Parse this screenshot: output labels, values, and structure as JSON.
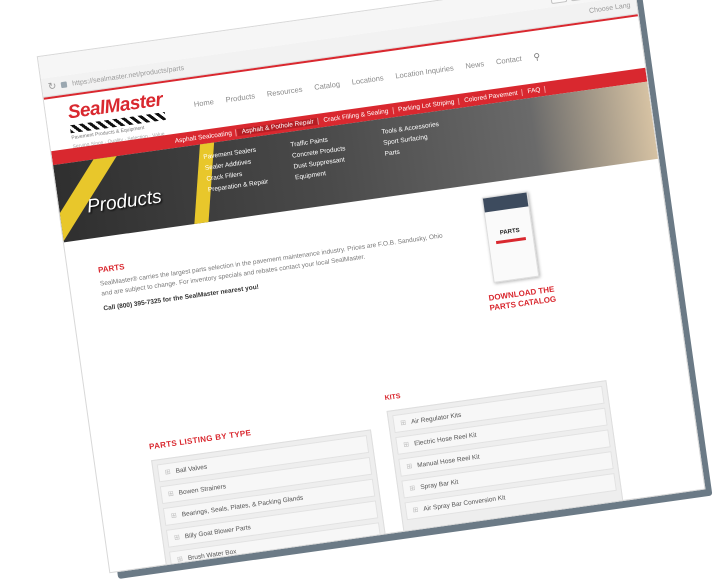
{
  "browser": {
    "url": "https://sealmaster.net/products/parts",
    "signin": "Choose Lang",
    "controls": [
      "☰",
      "–",
      "❐",
      "✕"
    ]
  },
  "logo": {
    "name": "SealMaster",
    "subtitle": "Pavement Products & Equipment",
    "tagline": "Serving Since · Quality · Selection · Value"
  },
  "nav": {
    "items": [
      "Home",
      "Products",
      "Resources",
      "Catalog",
      "Locations",
      "Location Inquiries",
      "News",
      "Contact"
    ]
  },
  "categories": {
    "items": [
      "Asphalt Sealcoating",
      "Asphalt & Pothole Repair",
      "Crack Filling & Sealing",
      "Parking Lot Striping",
      "Colored Pavement",
      "FAQ"
    ],
    "active_index": 1
  },
  "hero": {
    "title": "Products",
    "col1": [
      "Pavement Sealers",
      "Sealer Additives",
      "Crack Fillers",
      "Preparation & Repair"
    ],
    "col2": [
      "Traffic Paints",
      "Concrete Products",
      "Dust Suppressant",
      "Equipment"
    ],
    "col3": [
      "Tools & Accessories",
      "Sport Surfacing",
      "Parts"
    ]
  },
  "parts": {
    "heading": "PARTS",
    "description": "SealMaster® carries the largest parts selection in the pavement maintenance industry. Prices are F.O.B. Sandusky, Ohio and are subject to change. For inventory specials and rebates contact your local SealMaster.",
    "call": "Call (800) 395-7325 for the SealMaster nearest you!"
  },
  "catalog": {
    "thumb_title": "PARTS",
    "download": "DOWNLOAD THE PARTS CATALOG"
  },
  "listing": {
    "heading": "PARTS LISTING BY TYPE",
    "items": [
      "Ball Valves",
      "Bowen Strainers",
      "Bearings, Seals, Plates, & Packing Glands",
      "Billy Goat Blower Parts",
      "Brush Water Box"
    ]
  },
  "kits": {
    "heading": "KITS",
    "items": [
      "Air Regulator Kits",
      "Electric Hose Reel Kit",
      "Manual Hose Reel Kit",
      "Spray Bar Kit",
      "Air Spray Bar Conversion Kit"
    ]
  },
  "colors": {
    "brand_red": "#d9282f",
    "stripe_yellow": "#e8c72b"
  }
}
